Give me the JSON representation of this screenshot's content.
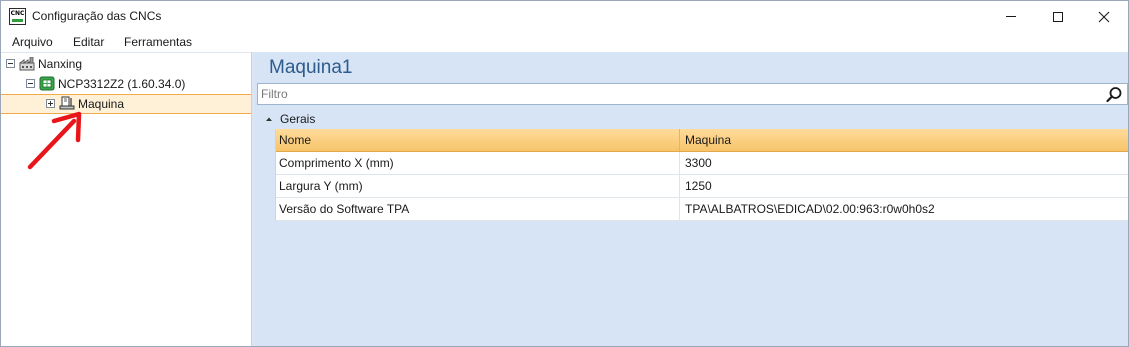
{
  "window": {
    "title": "Configuração das CNCs",
    "icon_text": "CNC"
  },
  "menu": {
    "items": [
      "Arquivo",
      "Editar",
      "Ferramentas"
    ]
  },
  "tree": {
    "nodes": [
      {
        "label": "Nanxing",
        "icon": "factory-icon",
        "expander": "minus"
      },
      {
        "label": "NCP3312Z2 (1.60.34.0)",
        "icon": "cnc-controller-icon",
        "expander": "minus"
      },
      {
        "label": "Maquina",
        "icon": "machine-icon",
        "expander": "plus",
        "selected": true
      }
    ]
  },
  "panel": {
    "title": "Maquina1",
    "filter": {
      "placeholder": "Filtro",
      "value": ""
    },
    "group": {
      "label": "Gerais",
      "expanded": true
    },
    "grid": {
      "columns": [
        "Nome",
        "Maquina"
      ],
      "rows": [
        [
          "Comprimento X (mm)",
          "3300"
        ],
        [
          "Largura Y (mm)",
          "1250"
        ],
        [
          "Versão do Software TPA",
          "TPA\\ALBATROS\\EDICAD\\02.00:963:r0w0h0s2"
        ]
      ]
    }
  },
  "colors": {
    "accent_orange": "#f7c46a",
    "selection_bg": "#fff1d7",
    "panel_bg": "#d6e4f6",
    "title_blue": "#2f5b8a",
    "annotation_red": "#e8161b"
  }
}
